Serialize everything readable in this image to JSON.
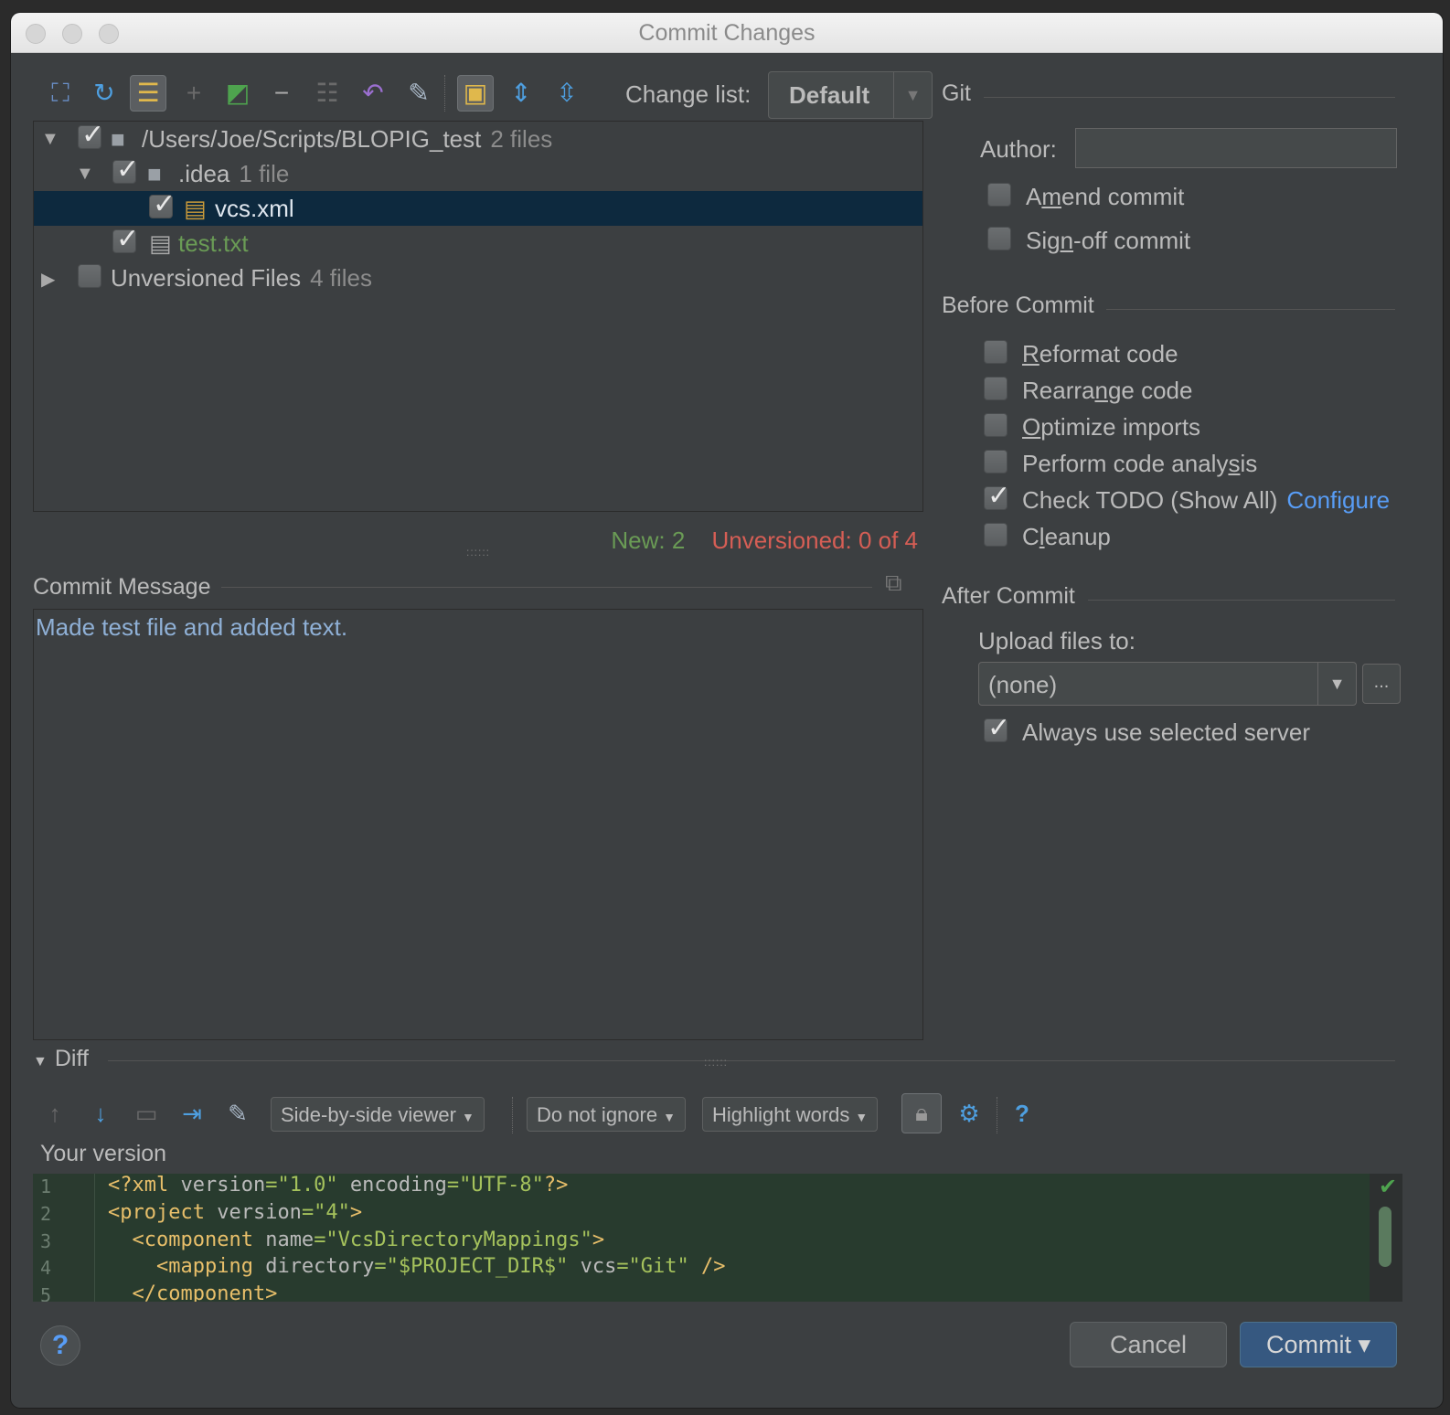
{
  "window": {
    "title": "Commit Changes"
  },
  "toolbar": {
    "change_list_label": "Change list:",
    "change_list_value": "Default"
  },
  "tree": {
    "rows": [
      {
        "name": "/Users/Joe/Scripts/BLOPIG_test",
        "meta": "2 files"
      },
      {
        "name": ".idea",
        "meta": "1 file"
      },
      {
        "name": "vcs.xml",
        "meta": ""
      },
      {
        "name": "test.txt",
        "meta": ""
      },
      {
        "name": "Unversioned Files",
        "meta": "4 files"
      }
    ]
  },
  "counts": {
    "new": "New: 2",
    "unversioned": "Unversioned: 0 of 4"
  },
  "commit_message": {
    "title": "Commit Message",
    "text": "Made test file and added text."
  },
  "git": {
    "title": "Git",
    "author_label": "Author:",
    "author_value": "",
    "amend": {
      "pre": "A",
      "u": "m",
      "post": "end commit",
      "checked": false
    },
    "signoff": {
      "pre": "Sig",
      "u": "n",
      "post": "-off commit",
      "checked": false
    }
  },
  "before_commit": {
    "title": "Before Commit",
    "options": [
      {
        "pre": "",
        "u": "R",
        "post": "eformat code",
        "checked": false
      },
      {
        "pre": "Rearra",
        "u": "n",
        "post": "ge code",
        "checked": false
      },
      {
        "pre": "",
        "u": "O",
        "post": "ptimize imports",
        "checked": false
      },
      {
        "pre": "Perform code analy",
        "u": "s",
        "post": "is",
        "checked": false
      },
      {
        "pre": "Check TODO (Show All)",
        "u": "",
        "post": "",
        "checked": true
      },
      {
        "pre": "C",
        "u": "l",
        "post": "eanup",
        "checked": false
      }
    ],
    "configure_link": "Configure"
  },
  "after_commit": {
    "title": "After Commit",
    "upload_label": "Upload files to:",
    "upload_value": "(none)",
    "upload_more": "...",
    "always_label": "Always use selected server"
  },
  "diff": {
    "title": "Diff",
    "viewer": "Side-by-side viewer",
    "ignore": "Do not ignore",
    "highlight": "Highlight words",
    "your_version": "Your version",
    "lines": [
      {
        "n": "1"
      },
      {
        "n": "2"
      },
      {
        "n": "3"
      },
      {
        "n": "4"
      },
      {
        "n": "5"
      }
    ],
    "code": {
      "l1_tag1": "<?xml",
      "l1_attr1": " version",
      "l1_str1": "=\"1.0\"",
      "l1_attr2": " encoding",
      "l1_str2": "=\"UTF-8\"",
      "l1_tag2": "?>",
      "l2_tag1": "<project",
      "l2_attr1": " version",
      "l2_str1": "=\"4\"",
      "l2_tag2": ">",
      "l3_tag1": "  <component",
      "l3_attr1": " name",
      "l3_str1": "=\"VcsDirectoryMappings\"",
      "l3_tag2": ">",
      "l4_tag1": "    <mapping",
      "l4_attr1": " directory",
      "l4_str1": "=\"$PROJECT_DIR$\"",
      "l4_attr2": " vcs",
      "l4_str2": "=\"Git\"",
      "l4_tag2": " />",
      "l5_tag1": "  </component>"
    }
  },
  "buttons": {
    "help": "?",
    "cancel": "Cancel",
    "commit": "Commit ▾"
  },
  "colors": {
    "accent": "#589df6",
    "new": "#6a9b55",
    "unversioned": "#d65e55",
    "selection": "#0d293e"
  }
}
